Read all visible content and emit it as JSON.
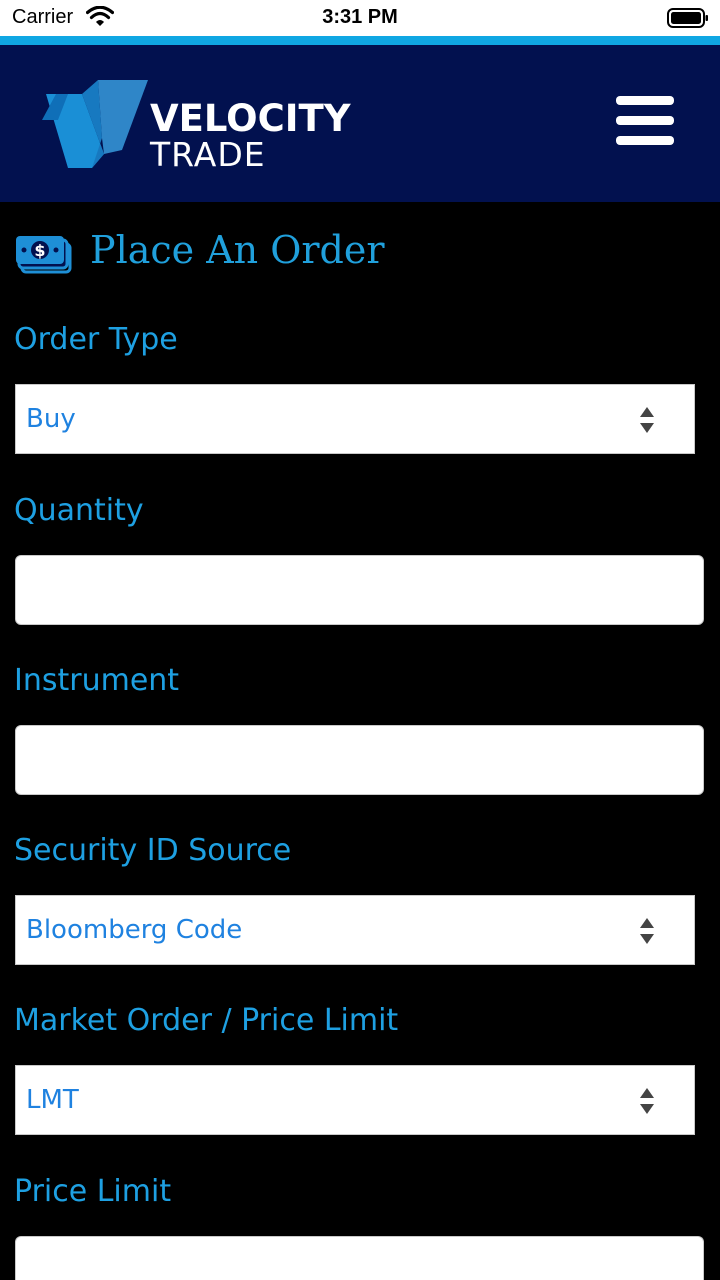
{
  "status_bar": {
    "carrier": "Carrier",
    "time": "3:31 PM"
  },
  "header": {
    "logo_line1": "VELOCITY",
    "logo_line2": "TRADE",
    "menu_icon": "hamburger-menu-icon"
  },
  "page": {
    "title": "Place An Order",
    "title_icon": "money-stack-icon"
  },
  "form": {
    "order_type": {
      "label": "Order Type",
      "value": "Buy"
    },
    "quantity": {
      "label": "Quantity",
      "value": ""
    },
    "instrument": {
      "label": "Instrument",
      "value": ""
    },
    "security_id_source": {
      "label": "Security ID Source",
      "value": "Bloomberg Code"
    },
    "market_order_price_limit": {
      "label": "Market Order / Price Limit",
      "value": "LMT"
    },
    "price_limit": {
      "label": "Price Limit",
      "value": ""
    }
  },
  "colors": {
    "accent": "#10a7e3",
    "header_bg": "#02114f",
    "label": "#1ea0e2",
    "select_text": "#1f82e0",
    "background": "#000000"
  }
}
